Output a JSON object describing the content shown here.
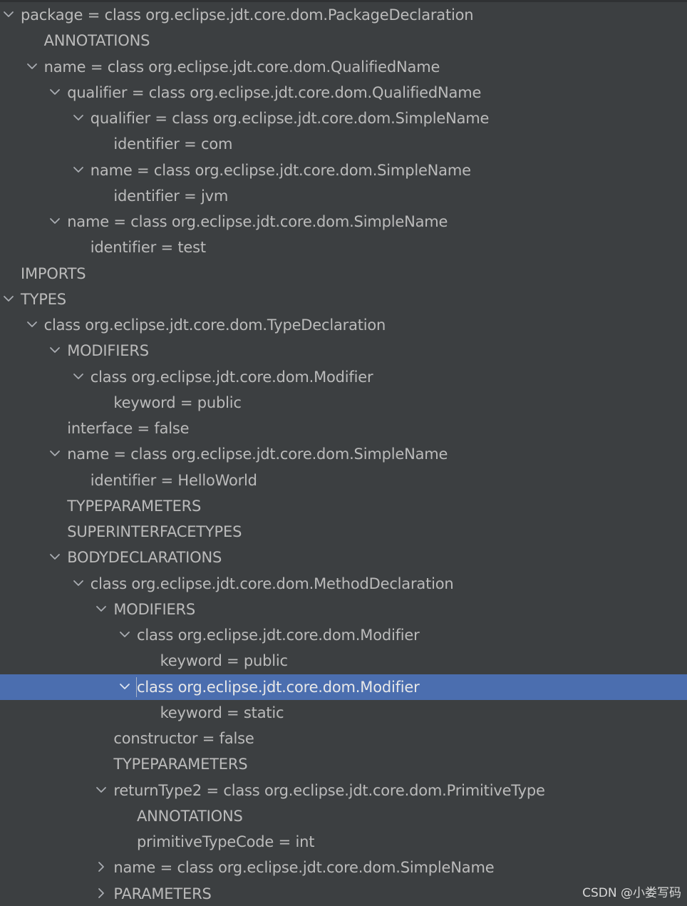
{
  "tree": {
    "rows": [
      {
        "level": 0,
        "arrow": "expanded",
        "label": "package = class org.eclipse.jdt.core.dom.PackageDeclaration"
      },
      {
        "level": 1,
        "arrow": "none",
        "label": "ANNOTATIONS"
      },
      {
        "level": 1,
        "arrow": "expanded",
        "label": "name = class org.eclipse.jdt.core.dom.QualifiedName"
      },
      {
        "level": 2,
        "arrow": "expanded",
        "label": "qualifier = class org.eclipse.jdt.core.dom.QualifiedName"
      },
      {
        "level": 3,
        "arrow": "expanded",
        "label": "qualifier = class org.eclipse.jdt.core.dom.SimpleName"
      },
      {
        "level": 4,
        "arrow": "none",
        "label": "identifier = com"
      },
      {
        "level": 3,
        "arrow": "expanded",
        "label": "name = class org.eclipse.jdt.core.dom.SimpleName"
      },
      {
        "level": 4,
        "arrow": "none",
        "label": "identifier = jvm"
      },
      {
        "level": 2,
        "arrow": "expanded",
        "label": "name = class org.eclipse.jdt.core.dom.SimpleName"
      },
      {
        "level": 3,
        "arrow": "none",
        "label": "identifier = test"
      },
      {
        "level": 0,
        "arrow": "none",
        "label": "IMPORTS"
      },
      {
        "level": 0,
        "arrow": "expanded",
        "label": "TYPES"
      },
      {
        "level": 1,
        "arrow": "expanded",
        "label": "class org.eclipse.jdt.core.dom.TypeDeclaration"
      },
      {
        "level": 2,
        "arrow": "expanded",
        "label": "MODIFIERS"
      },
      {
        "level": 3,
        "arrow": "expanded",
        "label": "class org.eclipse.jdt.core.dom.Modifier"
      },
      {
        "level": 4,
        "arrow": "none",
        "label": "keyword = public"
      },
      {
        "level": 2,
        "arrow": "none",
        "label": "interface = false"
      },
      {
        "level": 2,
        "arrow": "expanded",
        "label": "name = class org.eclipse.jdt.core.dom.SimpleName"
      },
      {
        "level": 3,
        "arrow": "none",
        "label": "identifier = HelloWorld"
      },
      {
        "level": 2,
        "arrow": "none",
        "label": "TYPEPARAMETERS"
      },
      {
        "level": 2,
        "arrow": "none",
        "label": "SUPERINTERFACETYPES"
      },
      {
        "level": 2,
        "arrow": "expanded",
        "label": "BODYDECLARATIONS"
      },
      {
        "level": 3,
        "arrow": "expanded",
        "label": "class org.eclipse.jdt.core.dom.MethodDeclaration"
      },
      {
        "level": 4,
        "arrow": "expanded",
        "label": "MODIFIERS"
      },
      {
        "level": 5,
        "arrow": "expanded",
        "label": "class org.eclipse.jdt.core.dom.Modifier"
      },
      {
        "level": 6,
        "arrow": "none",
        "label": "keyword = public"
      },
      {
        "level": 5,
        "arrow": "expanded",
        "label": "class org.eclipse.jdt.core.dom.Modifier",
        "selected": true
      },
      {
        "level": 6,
        "arrow": "none",
        "label": "keyword = static"
      },
      {
        "level": 4,
        "arrow": "none",
        "label": "constructor = false"
      },
      {
        "level": 4,
        "arrow": "none",
        "label": "TYPEPARAMETERS"
      },
      {
        "level": 4,
        "arrow": "expanded",
        "label": "returnType2 = class org.eclipse.jdt.core.dom.PrimitiveType"
      },
      {
        "level": 5,
        "arrow": "none",
        "label": "ANNOTATIONS"
      },
      {
        "level": 5,
        "arrow": "none",
        "label": "primitiveTypeCode = int"
      },
      {
        "level": 4,
        "arrow": "collapsed",
        "label": "name = class org.eclipse.jdt.core.dom.SimpleName"
      },
      {
        "level": 4,
        "arrow": "collapsed",
        "label": "PARAMETERS"
      }
    ]
  },
  "colors": {
    "background": "#3c3f41",
    "text": "#bbbbbb",
    "selection": "#4b6eaf"
  },
  "watermark": "CSDN @小娄写码"
}
